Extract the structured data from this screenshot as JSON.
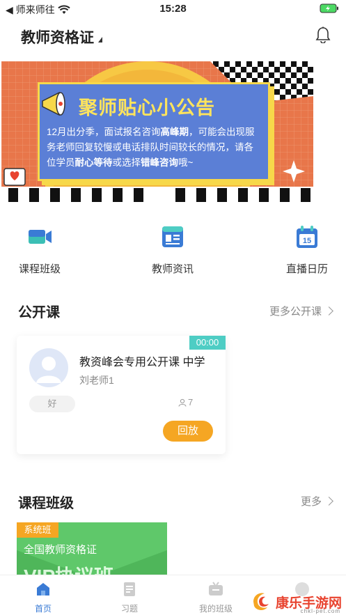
{
  "status_bar": {
    "carrier": "师来师往",
    "time": "15:28"
  },
  "header": {
    "title": "教师资格证"
  },
  "banner": {
    "title": "聚师贴心小公告",
    "body_parts": [
      {
        "text": "12月出分季，面试报名咨询",
        "bold": false
      },
      {
        "text": "高峰期",
        "bold": true
      },
      {
        "text": "，可能会出现服务老师回复较慢或电话排队时间较长的情况，请各位学员",
        "bold": false
      },
      {
        "text": "耐心等待",
        "bold": true
      },
      {
        "text": "或选择",
        "bold": false
      },
      {
        "text": "错峰咨询",
        "bold": true
      },
      {
        "text": "哦~",
        "bold": false
      }
    ],
    "colors": {
      "background": "#e8764a",
      "card": "#5b7fd6",
      "accent": "#f7d84a"
    }
  },
  "quick_nav": [
    {
      "label": "课程班级",
      "icon": "video-camera-icon"
    },
    {
      "label": "教师资讯",
      "icon": "news-icon"
    },
    {
      "label": "直播日历",
      "icon": "calendar-icon",
      "icon_text": "15"
    }
  ],
  "open_course": {
    "title": "公开课",
    "more_label": "更多公开课",
    "card": {
      "timer": "00:00",
      "name": "教资峰会专用公开课 中学",
      "teacher": "刘老师1",
      "rating": "好",
      "viewers": "7",
      "replay_label": "回放"
    }
  },
  "class_section": {
    "title": "课程班级",
    "more_label": "更多",
    "card": {
      "tag": "系统班",
      "subtitle": "全国教师资格证",
      "big_text": "VIP协议班"
    }
  },
  "tab_bar": [
    {
      "label": "首页",
      "icon": "home-icon",
      "active": true
    },
    {
      "label": "习题",
      "icon": "exercise-icon",
      "active": false
    },
    {
      "label": "我的班级",
      "icon": "tv-icon",
      "active": false
    },
    {
      "label": "",
      "icon": "profile-icon",
      "active": false
    }
  ],
  "watermark": {
    "text": "康乐手游网",
    "sub": "chkl-pet.com"
  },
  "colors": {
    "accent": "#3a7bd5",
    "orange": "#f5a623",
    "teal": "#4ecdc4",
    "green": "#5fc86a"
  }
}
